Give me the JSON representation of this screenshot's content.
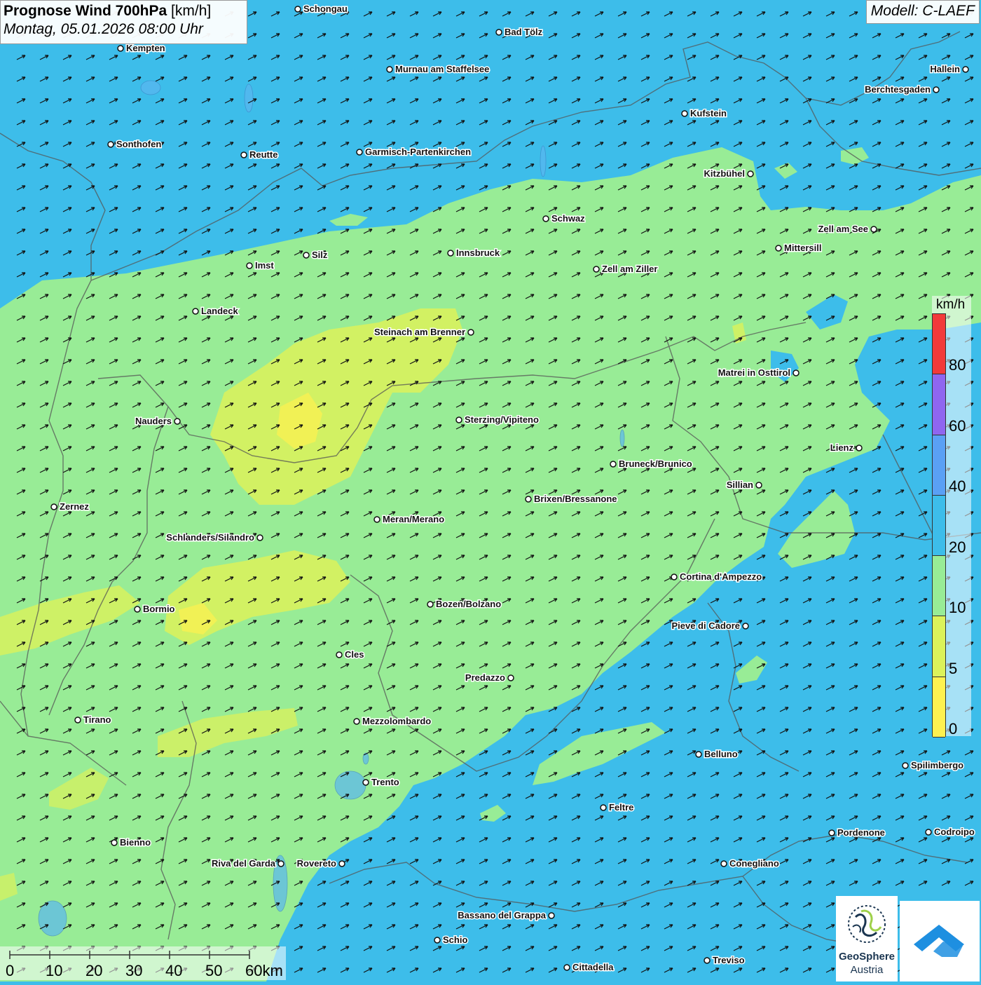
{
  "header": {
    "title_bold": "Prognose Wind 700hPa",
    "title_unit": "[km/h]",
    "datetime": "Montag, 05.01.2026 08:00 Uhr",
    "model": "Modell: C-LAEF"
  },
  "legend": {
    "unit": "km/h",
    "labels": [
      "80",
      "60",
      "40",
      "20",
      "10",
      "5",
      "0"
    ],
    "colors": [
      "#f23a3a",
      "#8f66f0",
      "#5aa0f5",
      "#3dbdea",
      "#98ec96",
      "#dcf25a",
      "#fef150"
    ]
  },
  "scale": {
    "labels": [
      "0",
      "10",
      "20",
      "30",
      "40",
      "50",
      "60km"
    ]
  },
  "logos": {
    "geosphere_line1": "GeoSphere",
    "geosphere_line2": "Austria"
  },
  "places": [
    {
      "name": "Schongau"
    },
    {
      "name": "Bad Tölz"
    },
    {
      "name": "Kempten"
    },
    {
      "name": "Murnau am Staffelsee"
    },
    {
      "name": "Hallein"
    },
    {
      "name": "Berchtesgaden"
    },
    {
      "name": "Kufstein"
    },
    {
      "name": "Sonthofen"
    },
    {
      "name": "Reutte"
    },
    {
      "name": "Garmisch-Partenkirchen"
    },
    {
      "name": "Kitzbühel"
    },
    {
      "name": "Schwaz"
    },
    {
      "name": "Zell am See"
    },
    {
      "name": "Mittersill"
    },
    {
      "name": "Innsbruck"
    },
    {
      "name": "Silz"
    },
    {
      "name": "Imst"
    },
    {
      "name": "Zell am Ziller"
    },
    {
      "name": "Landeck"
    },
    {
      "name": "Steinach am Brenner"
    },
    {
      "name": "Matrei in Osttirol"
    },
    {
      "name": "Nauders"
    },
    {
      "name": "Sterzing/Vipiteno"
    },
    {
      "name": "Lienz"
    },
    {
      "name": "Bruneck/Brunico"
    },
    {
      "name": "Sillian"
    },
    {
      "name": "Brixen/Bressanone"
    },
    {
      "name": "Zernez"
    },
    {
      "name": "Meran/Merano"
    },
    {
      "name": "Schlanders/Silandro"
    },
    {
      "name": "Cortina d'Ampezzo"
    },
    {
      "name": "Bozen/Bolzano"
    },
    {
      "name": "Bormio"
    },
    {
      "name": "Pieve di Cadore"
    },
    {
      "name": "Cles"
    },
    {
      "name": "Predazzo"
    },
    {
      "name": "Tirano"
    },
    {
      "name": "Mezzolombardo"
    },
    {
      "name": "Belluno"
    },
    {
      "name": "Spilimbergo"
    },
    {
      "name": "Trento"
    },
    {
      "name": "Feltre"
    },
    {
      "name": "Pordenone"
    },
    {
      "name": "Codroipo"
    },
    {
      "name": "Bienno"
    },
    {
      "name": "Riva del Garda"
    },
    {
      "name": "Rovereto"
    },
    {
      "name": "Conegliano"
    },
    {
      "name": "Bassano del Grappa"
    },
    {
      "name": "Schio"
    },
    {
      "name": "Treviso"
    },
    {
      "name": "Cittadella"
    }
  ]
}
